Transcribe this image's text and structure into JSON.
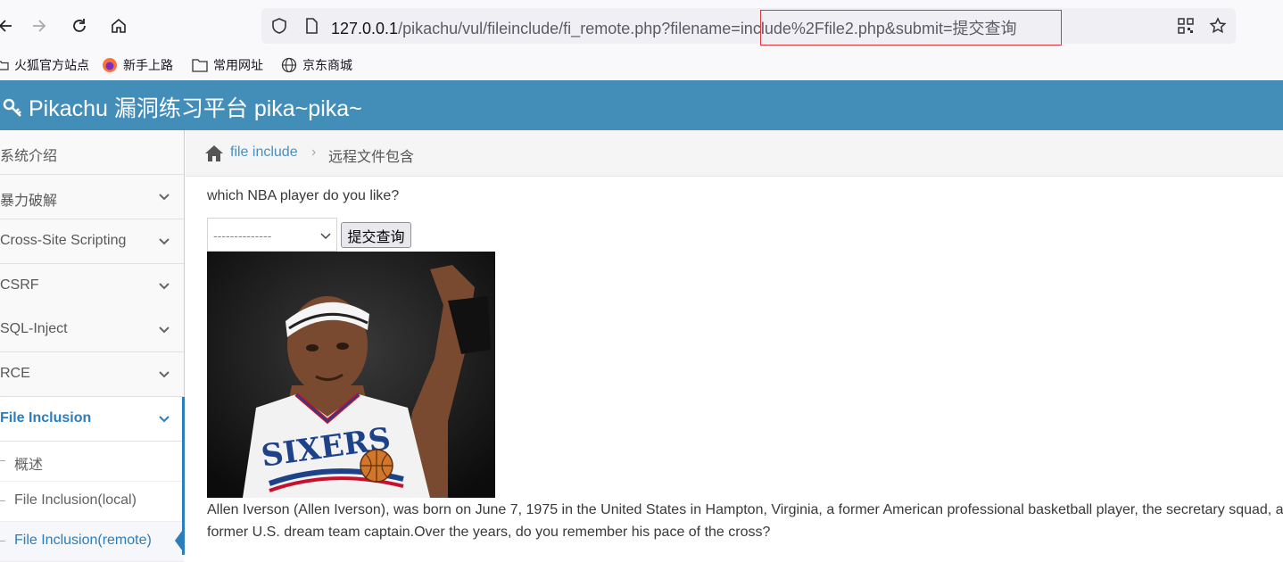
{
  "browser": {
    "url_host": "127.0.0.1",
    "url_path": "/pikachu/vul/fileinclude/fi_remote.php?filename=",
    "url_query": "include%2Ffile2.php&submit=提交查询"
  },
  "bookmarks": [
    {
      "label": "火狐官方站点",
      "icon": "folder-icon"
    },
    {
      "label": "新手上路",
      "icon": "firefox-icon"
    },
    {
      "label": "常用网址",
      "icon": "folder-icon"
    },
    {
      "label": "京东商城",
      "icon": "globe-icon"
    }
  ],
  "header": {
    "title": "Pikachu 漏洞练习平台 pika~pika~"
  },
  "sidebar": {
    "items": [
      {
        "label": "系统介绍"
      },
      {
        "label": "暴力破解"
      },
      {
        "label": "Cross-Site Scripting"
      },
      {
        "label": "CSRF"
      },
      {
        "label": "SQL-Inject"
      },
      {
        "label": "RCE"
      },
      {
        "label": "File Inclusion"
      }
    ],
    "subitems": [
      {
        "label": "概述"
      },
      {
        "label": "File Inclusion(local)"
      },
      {
        "label": "File Inclusion(remote)"
      }
    ]
  },
  "breadcrumb": {
    "link": "file include",
    "current": "远程文件包含"
  },
  "main": {
    "question": "which NBA player do you like?",
    "select_value": "--------------",
    "submit_label": "提交查询",
    "jersey_text": "SIXERS",
    "description": "Allen Iverson (Allen Iverson), was born on June 7, 1975 in the United States in Hampton, Virginia, a former American professional basketball player, the secretary squad, a former U.S. dream team captain.Over the years, do you remember his pace of the cross?"
  },
  "colors": {
    "header": "#438eb9",
    "accent": "#2b7dbc",
    "highlight": "#e0353b"
  }
}
